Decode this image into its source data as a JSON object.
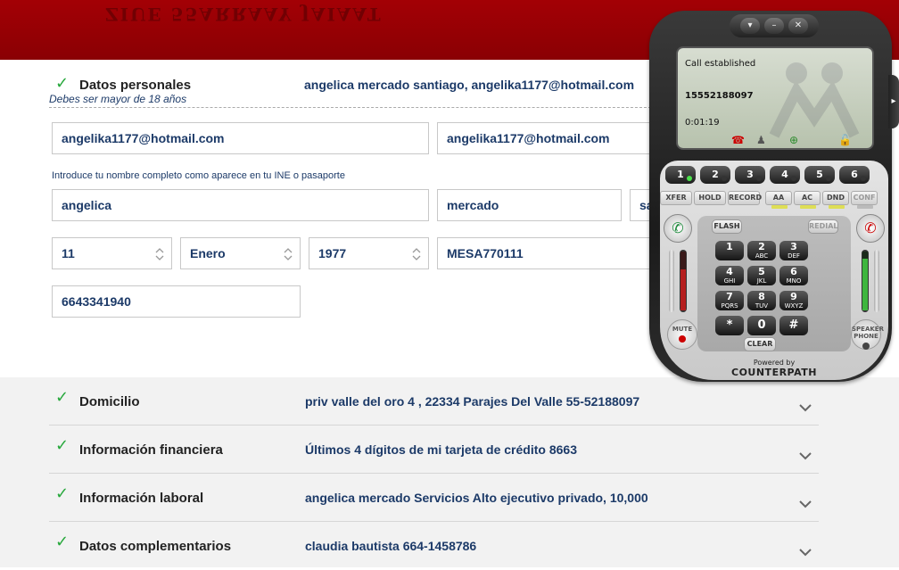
{
  "header": {
    "mirror_text": "ZIUE 55ARRAAY JAIAAT"
  },
  "personal": {
    "title": "Datos personales",
    "summary": "angelica mercado santiago, angelika1177@hotmail.com",
    "age_hint": "Debes ser mayor de 18 años",
    "email": "angelika1177@hotmail.com",
    "email_confirm": "angelika1177@hotmail.com",
    "name_note": "Introduce tu nombre completo como aparece en tu INE o pasaporte",
    "first_name": "angelica",
    "last_name_1": "mercado",
    "last_name_2": "santiago",
    "birth_day": "11",
    "birth_month": "Enero",
    "birth_year": "1977",
    "rfc": "MESA770111",
    "phone": "6643341940"
  },
  "sections": [
    {
      "title": "Domicilio",
      "summary": "priv valle del oro 4 , 22334 Parajes Del Valle 55-52188097"
    },
    {
      "title": "Información financiera",
      "summary": "Últimos 4 dígitos de mi tarjeta de crédito 8663"
    },
    {
      "title": "Información laboral",
      "summary": "angelica mercado Servicios Alto ejecutivo privado, 10,000"
    },
    {
      "title": "Datos complementarios",
      "summary": "claudia bautista 664-1458786"
    }
  ],
  "softphone": {
    "status": "Call established",
    "number": "15552188097",
    "timer": "0:01:19",
    "lines": [
      "1",
      "2",
      "3",
      "4",
      "5",
      "6"
    ],
    "functions": [
      "XFER",
      "HOLD",
      "RECORD",
      "AA",
      "AC",
      "DND",
      "CONF"
    ],
    "flash": "FLASH",
    "redial": "REDIAL",
    "keys": [
      {
        "d": "1",
        "l": ""
      },
      {
        "d": "2",
        "l": "ABC"
      },
      {
        "d": "3",
        "l": "DEF"
      },
      {
        "d": "4",
        "l": "GHI"
      },
      {
        "d": "5",
        "l": "JKL"
      },
      {
        "d": "6",
        "l": "MNO"
      },
      {
        "d": "7",
        "l": "PQRS"
      },
      {
        "d": "8",
        "l": "TUV"
      },
      {
        "d": "9",
        "l": "WXYZ"
      },
      {
        "d": "*",
        "l": ""
      },
      {
        "d": "0",
        "l": ""
      },
      {
        "d": "#",
        "l": ""
      }
    ],
    "clear": "CLEAR",
    "mute": "MUTE",
    "speaker": "SPEAKER PHONE",
    "powered_by": "Powered by",
    "brand": "CounterPath",
    "colors": {
      "green": "#27a83c",
      "red": "#c00000"
    }
  }
}
